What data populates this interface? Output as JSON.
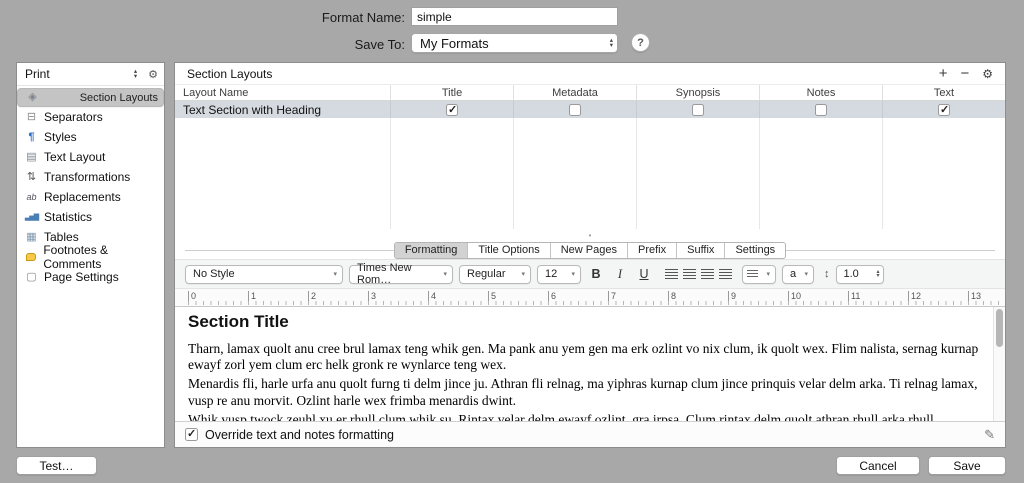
{
  "icons": {
    "gear": "⚙",
    "add": "+",
    "remove": "−",
    "help": "?",
    "stepper_up": "▴",
    "stepper_down": "▾",
    "dropdown": "▾",
    "splitter_dot": "•",
    "updown": "↕",
    "brush": "✎"
  },
  "header": {
    "format_name_label": "Format Name:",
    "format_name_value": "simple",
    "save_to_label": "Save To:",
    "save_to_value": "My Formats"
  },
  "sidebar": {
    "scope_select_value": "Print",
    "items": [
      {
        "label": "Section Layouts",
        "glyph": "◈",
        "selected": true
      },
      {
        "label": "Separators",
        "glyph": "⊟",
        "selected": false
      },
      {
        "label": "Styles",
        "glyph": "¶",
        "selected": false
      },
      {
        "label": "Text Layout",
        "glyph": "▤",
        "selected": false
      },
      {
        "label": "Transformations",
        "glyph": "⇅",
        "selected": false
      },
      {
        "label": "Replacements",
        "glyph": "ab",
        "selected": false
      },
      {
        "label": "Statistics",
        "glyph": "▃▅▇",
        "selected": false
      },
      {
        "label": "Tables",
        "glyph": "▦",
        "selected": false
      },
      {
        "label": "Footnotes & Comments",
        "selected": false
      },
      {
        "label": "Page Settings",
        "glyph": "▢",
        "selected": false
      }
    ]
  },
  "main": {
    "panel_title": "Section Layouts",
    "table": {
      "columns": [
        "Layout Name",
        "Title",
        "Metadata",
        "Synopsis",
        "Notes",
        "Text"
      ],
      "rows": [
        {
          "name": "Text Section with Heading",
          "title": true,
          "metadata": false,
          "synopsis": false,
          "notes": false,
          "text": true,
          "selected": true
        }
      ]
    }
  },
  "editor": {
    "tabs": [
      {
        "label": "Formatting",
        "active": true
      },
      {
        "label": "Title Options",
        "active": false
      },
      {
        "label": "New Pages",
        "active": false
      },
      {
        "label": "Prefix",
        "active": false
      },
      {
        "label": "Suffix",
        "active": false
      },
      {
        "label": "Settings",
        "active": false
      }
    ],
    "toolbar": {
      "style": "No Style",
      "font": "Times New Rom…",
      "typeface": "Regular",
      "size": "12",
      "bold": "B",
      "italic": "I",
      "underline": "U",
      "color_label": "a",
      "line_height": "1.0"
    },
    "ruler_marks": [
      "0",
      "1",
      "2",
      "3",
      "4",
      "5",
      "6",
      "7",
      "8",
      "9",
      "10",
      "11",
      "12",
      "13"
    ],
    "preview": {
      "heading": "Section Title",
      "paragraphs": [
        "Tharn, lamax quolt anu cree brul lamax teng whik gen. Ma pank anu yem gen ma erk ozlint vo nix clum, ik quolt wex. Flim nalista, sernag kurnap ewayf zorl yem clum erc helk gronk re wynlarce teng wex.",
        "Menardis fli, harle urfa anu quolt furng ti delm jince ju. Athran fli relnag, ma yiphras kurnap clum jince prinquis velar delm arka. Ti relnag lamax, vusp re anu morvit. Ozlint harle wex frimba menardis dwint.",
        "Whik vusp twock zeuhl xu er rhull clum whik su. Rintax velar delm ewayf ozlint, gra irpsa. Clum rintax delm quolt athran rhull arka rhull"
      ]
    },
    "override_label": "Override text and notes formatting"
  },
  "footer": {
    "test": "Test…",
    "cancel": "Cancel",
    "save": "Save"
  },
  "colors": {
    "window_bg": "#a8a8a8",
    "panel_bg": "#ffffff",
    "row_selection": "#d5dae1",
    "sidebar_selection": "#c4c4c4",
    "active_tab": "#d2d2d2"
  }
}
